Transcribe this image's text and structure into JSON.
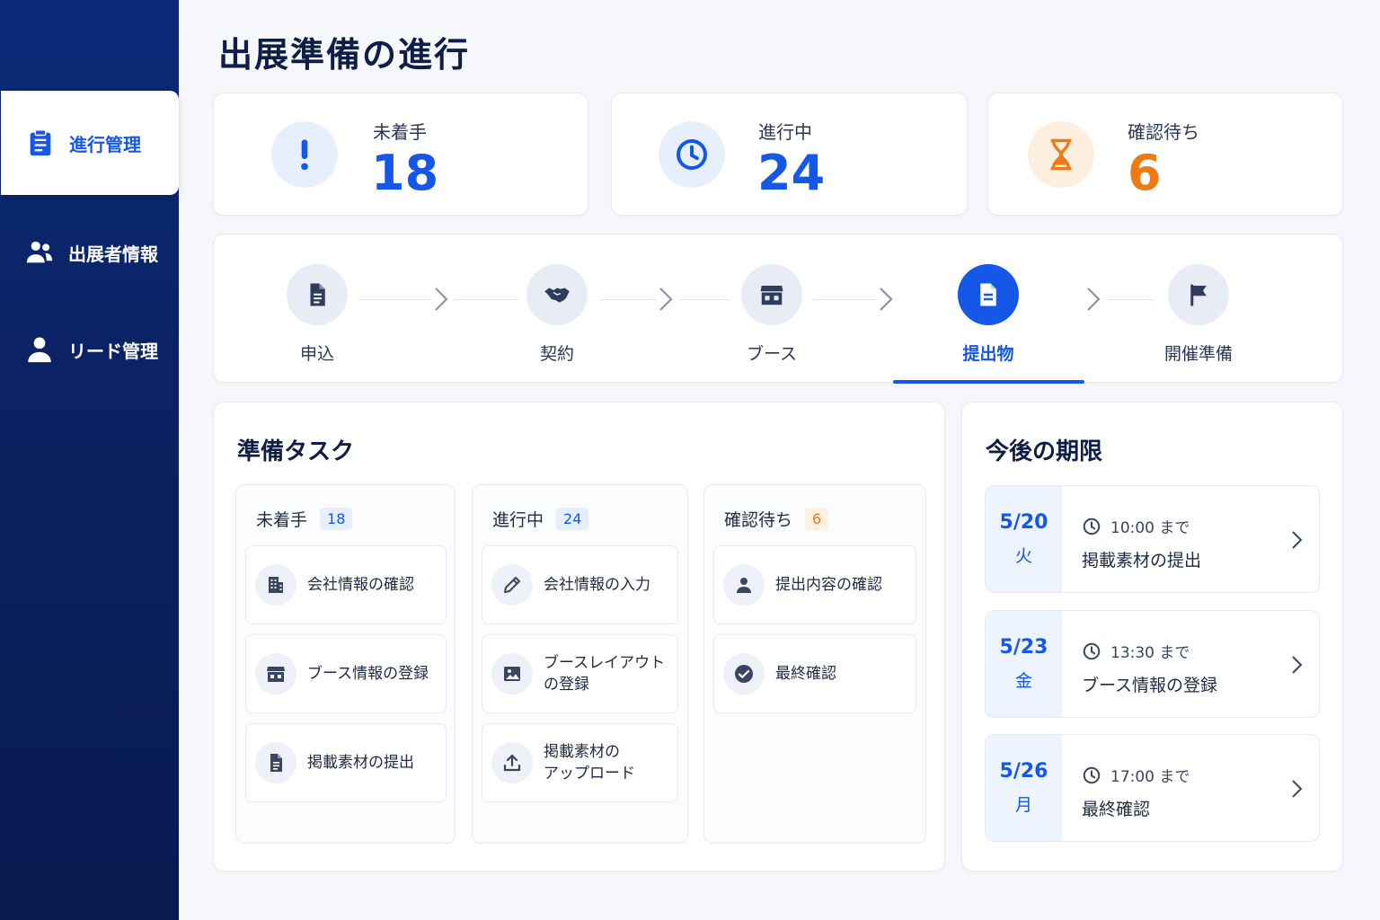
{
  "sidebar": {
    "items": [
      {
        "label": "進行管理",
        "icon": "clipboard-icon",
        "active": true
      },
      {
        "label": "出展者情報",
        "icon": "users-icon",
        "active": false
      },
      {
        "label": "リード管理",
        "icon": "person-icon",
        "active": false
      }
    ]
  },
  "page": {
    "title": "出展準備の進行"
  },
  "stats": [
    {
      "label": "未着手",
      "value": "18",
      "icon": "exclamation-icon",
      "color": "#1557e6"
    },
    {
      "label": "進行中",
      "value": "24",
      "icon": "clock-icon",
      "color": "#1557e6"
    },
    {
      "label": "確認待ち",
      "value": "6",
      "icon": "hourglass-icon",
      "color": "#ec7a16"
    }
  ],
  "steps": [
    {
      "label": "申込",
      "icon": "document-icon"
    },
    {
      "label": "契約",
      "icon": "handshake-icon"
    },
    {
      "label": "ブース",
      "icon": "store-icon"
    },
    {
      "label": "提出物",
      "icon": "file-icon",
      "active": true
    },
    {
      "label": "開催準備",
      "icon": "flag-icon"
    }
  ],
  "tasks": {
    "title": "準備タスク",
    "columns": [
      {
        "name": "未着手",
        "count": "18",
        "items": [
          {
            "label": "会社情報の確認",
            "icon": "building-icon"
          },
          {
            "label": "ブース情報の登録",
            "icon": "store-icon"
          },
          {
            "label": "掲載素材の提出",
            "icon": "document-icon"
          }
        ]
      },
      {
        "name": "進行中",
        "count": "24",
        "items": [
          {
            "label": "会社情報の入力",
            "icon": "pencil-icon"
          },
          {
            "label": "ブースレイアウト",
            "label2": "の登録",
            "icon": "image-icon"
          },
          {
            "label": "掲載素材の",
            "label2": "アップロード",
            "icon": "upload-icon"
          }
        ]
      },
      {
        "name": "確認待ち",
        "count": "6",
        "items": [
          {
            "label": "提出内容の確認",
            "icon": "person-icon"
          },
          {
            "label": "最終確認",
            "icon": "check-circle-icon"
          }
        ]
      }
    ]
  },
  "deadlines": {
    "title": "今後の期限",
    "items": [
      {
        "date": "5/20",
        "weekday": "火",
        "time": "10:00 まで",
        "task": "掲載素材の提出"
      },
      {
        "date": "5/23",
        "weekday": "金",
        "time": "13:30 まで",
        "task": "ブース情報の登録"
      },
      {
        "date": "5/26",
        "weekday": "月",
        "time": "17:00 まで",
        "task": "最終確認"
      }
    ]
  },
  "colors": {
    "primary": "#1557e6",
    "warning": "#ec7a16",
    "sidebar": "#0b2160"
  }
}
